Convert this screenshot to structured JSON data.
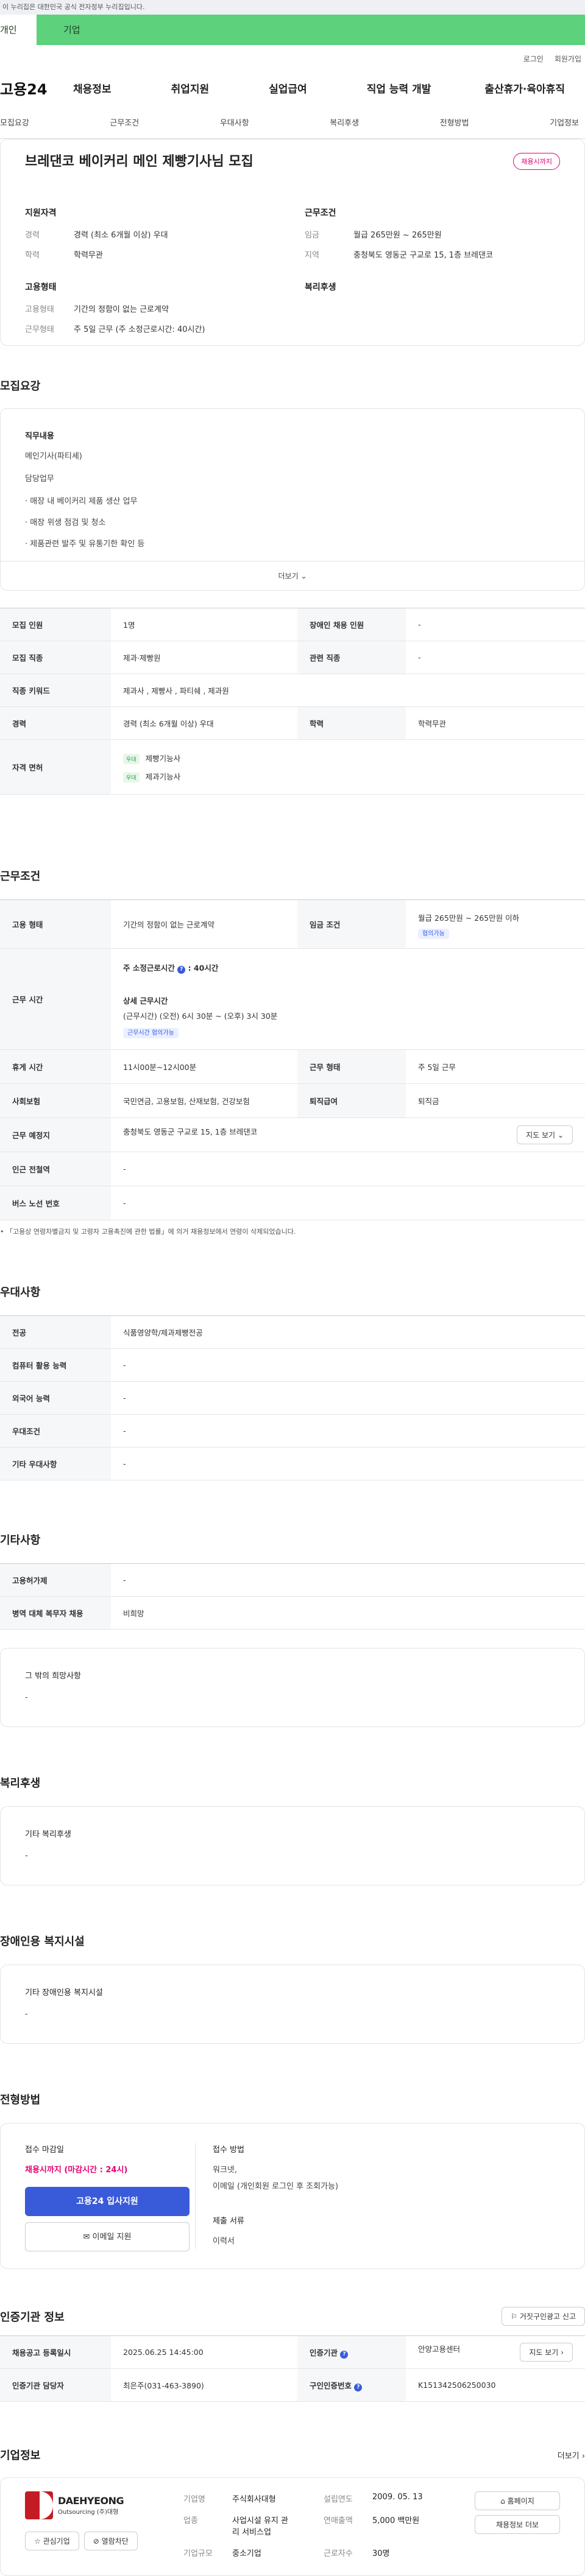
{
  "gov_banner": "이 누리집은 대한민국 공식 전자정부 누리집입니다.",
  "top_tabs": [
    "개인",
    "기업"
  ],
  "util_links": [
    "로그인",
    "회원가입"
  ],
  "logo": "고용24",
  "gnb": [
    "채용정보",
    "취업지원",
    "실업급여",
    "직업 능력 개발",
    "출산휴가·육아휴직"
  ],
  "lnb": [
    "모집요강",
    "근무조건",
    "우대사항",
    "복리후생",
    "전형방법",
    "기업정보"
  ],
  "summary": {
    "title": "브레댄코 베이커리 메인 제빵기사님 모집",
    "badge": "채용시까지",
    "qual_title": "지원자격",
    "cond_title": "근무조건",
    "emp_title": "고용형태",
    "welfare_title": "복리후생",
    "qual": [
      {
        "k": "경력",
        "v": "경력 (최소 6개월 이상) 우대"
      },
      {
        "k": "학력",
        "v": "학력무관"
      }
    ],
    "cond": [
      {
        "k": "임금",
        "v": "월급 265만원 ~ 265만원"
      },
      {
        "k": "지역",
        "v": "충청북도 영동군 구교로 15, 1층 브레댄코"
      }
    ],
    "emp": [
      {
        "k": "고용형태",
        "v": "기간의 정함이 없는 근로계약"
      },
      {
        "k": "근무형태",
        "v": "주 5일 근무 (주 소정근로시간: 40시간)"
      }
    ]
  },
  "recruit": {
    "title": "모집요강",
    "job_label": "직무내용",
    "job_lines": [
      "메인기사(파티셰)",
      "담당업무"
    ],
    "bullets": [
      "매장 내 베이커리 제품 생산 업무",
      "매장 위생 점검 및 청소",
      "제품관련 발주 및 유통기한 확인 등"
    ],
    "more": "더보기",
    "rows": {
      "people_h": "모집 인원",
      "people_v": "1명",
      "disabled_h": "장애인 채용 인원",
      "disabled_v": "-",
      "job_h": "모집 직종",
      "job_v": "제과·제빵원",
      "rel_h": "관련 직종",
      "rel_v": "-",
      "kw_h": "직종 키워드",
      "kw_v": "제과사 , 제빵사 , 파티쉐 , 제과원",
      "career_h": "경력",
      "career_v": "경력 (최소 6개월 이상) 우대",
      "edu_h": "학력",
      "edu_v": "학력무관",
      "lic_h": "자격 면허",
      "lic_tag": "우대",
      "lic1": "제빵기능사",
      "lic2": "제과기능사"
    }
  },
  "work": {
    "title": "근무조건",
    "type_h": "고용 형태",
    "type_v": "기간의 정함이 없는 근로계약",
    "pay_h": "임금 조건",
    "pay_v": "월급 265만원 ~ 265만원 이하",
    "pay_tag": "협의가능",
    "time_h": "근무 시간",
    "weekly": "주 소정근로시간 ",
    "weekly_val": ": 40시간",
    "detail_label": "상세 근무시간",
    "detail_val": "(근무시간) (오전) 6시 30분 ~ (오후) 3시 30분",
    "detail_tag": "근무시간 협의가능",
    "break_h": "휴게 시간",
    "break_v": "11시00분~12시00분",
    "form_h": "근무 형태",
    "form_v": "주 5일 근무",
    "ins_h": "사회보험",
    "ins_v": "국민연금, 고용보험, 산재보험, 건강보험",
    "ret_h": "퇴직급여",
    "ret_v": "퇴직금",
    "place_h": "근무 예정지",
    "place_v": "충청북도 영동군 구교로 15, 1층 브레댄코",
    "map_btn": "지도 보기",
    "sub_h": "인근 전철역",
    "sub_v": "-",
    "bus_h": "버스 노선 번호",
    "bus_v": "-",
    "note": "「고용상 연령차별금지 및 고령자 고용촉진에 관한 법률」에 의거 채용정보에서 연령이 삭제되었습니다."
  },
  "pref": {
    "title": "우대사항",
    "rows": [
      {
        "h": "전공",
        "v": "식품영양학/제과제빵전공"
      },
      {
        "h": "컴퓨터 활용 능력",
        "v": "-"
      },
      {
        "h": "외국어 능력",
        "v": "-"
      },
      {
        "h": "우대조건",
        "v": "-"
      },
      {
        "h": "기타 우대사항",
        "v": "-"
      }
    ]
  },
  "etc": {
    "title": "기타사항",
    "rows": [
      {
        "h": "고용허가제",
        "v": "-"
      },
      {
        "h": "병역 대체 복무자 채용",
        "v": "비희망"
      }
    ],
    "hope_label": "그 밖의 희망사항",
    "hope_v": "-"
  },
  "welfare": {
    "title": "복리후생",
    "label": "기타 복리후생",
    "v": "-"
  },
  "facility": {
    "title": "장애인용 복지시설",
    "label": "기타 장애인용 복지시설",
    "v": "-"
  },
  "apply": {
    "title": "전형방법",
    "deadline_label": "접수 마감일",
    "deadline_v": "채용시까지 (마감시간 : 24시)",
    "btn_apply": "고용24 입사지원",
    "btn_email": "이메일 지원",
    "method_label": "접수 방법",
    "method_v1": "워크넷,",
    "method_v2": "이메일 (개인회원 로그인 후 조회가능)",
    "doc_label": "제출 서류",
    "doc_v": "이력서"
  },
  "cert": {
    "title": "인증기관 정보",
    "report_btn": "거짓구인광고 신고",
    "date_h": "채용공고 등록일시",
    "date_v": "2025.06.25 14:45:00",
    "org_h": "인증기관",
    "org_v": "안양고용센터",
    "map_btn": "지도 보기",
    "mgr_h": "인증기관 담당자",
    "mgr_v": "최은주(031-463-3890)",
    "num_h": "구인인증번호",
    "num_v": "K151342506250030"
  },
  "company": {
    "title": "기업정보",
    "more": "더보기",
    "logo_main": "DAEHYEONG",
    "logo_sub": "Outsourcing",
    "logo_kr": "(주)대형",
    "interest_btn": "관심기업",
    "block_btn": "열람차단",
    "k1": "기업명",
    "v1": "주식회사대형",
    "k2": "업종",
    "v2a": "사업시설 유지 관",
    "v2b": "리 서비스업",
    "k3": "기업규모",
    "v3": "중소기업",
    "k4": "설립연도",
    "v4": "2009. 05. 13",
    "k5": "연매출액",
    "v5": "5,000 백만원",
    "k6": "근로자수",
    "v6": "30명",
    "hp_btn": "홈페이지",
    "other_btn": "채용정보 더보"
  }
}
